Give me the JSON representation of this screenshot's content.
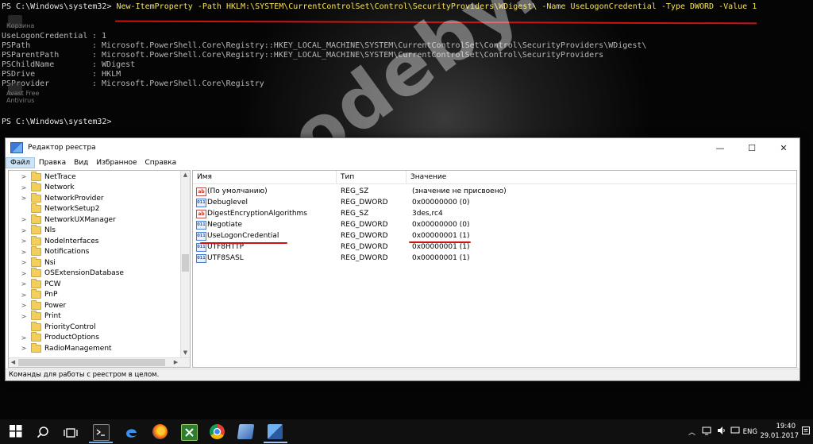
{
  "powershell": {
    "prompt1": "PS C:\\Windows\\system32> ",
    "command": "New-ItemProperty -Path HKLM:\\SYSTEM\\CurrentControlSet\\Control\\SecurityProviders\\WDigest\\ -Name UseLogonCredential -Type DWORD -Value 1",
    "output": [
      {
        "key": "UseLogonCredential",
        "value": ": 1"
      },
      {
        "key": "PSPath",
        "value": ": Microsoft.PowerShell.Core\\Registry::HKEY_LOCAL_MACHINE\\SYSTEM\\CurrentControlSet\\Control\\SecurityProviders\\WDigest\\"
      },
      {
        "key": "PSParentPath",
        "value": ": Microsoft.PowerShell.Core\\Registry::HKEY_LOCAL_MACHINE\\SYSTEM\\CurrentControlSet\\Control\\SecurityProviders"
      },
      {
        "key": "PSChildName",
        "value": ": WDigest"
      },
      {
        "key": "PSDrive",
        "value": ": HKLM"
      },
      {
        "key": "PSProvider",
        "value": ": Microsoft.PowerShell.Core\\Registry"
      }
    ],
    "prompt2": "PS C:\\Windows\\system32>"
  },
  "desktop": {
    "recycle_label": "Корзина",
    "avast_label1": "Avast Free",
    "avast_label2": "Antivirus"
  },
  "watermark": "codeby.net",
  "regedit": {
    "title": "Редактор реестра",
    "window_buttons": {
      "minimize": "—",
      "maximize": "☐",
      "close": "✕"
    },
    "menu": [
      "Файл",
      "Правка",
      "Вид",
      "Избранное",
      "Справка"
    ],
    "tree": [
      "NetTrace",
      "Network",
      "NetworkProvider",
      "NetworkSetup2",
      "NetworkUXManager",
      "Nls",
      "NodeInterfaces",
      "Notifications",
      "Nsi",
      "OSExtensionDatabase",
      "PCW",
      "PnP",
      "Power",
      "Print",
      "PriorityControl",
      "ProductOptions",
      "RadioManagement"
    ],
    "columns": {
      "name": "Имя",
      "type": "Тип",
      "value": "Значение"
    },
    "values": [
      {
        "icon": "ab",
        "name": "(По умолчанию)",
        "type": "REG_SZ",
        "data": "(значение не присвоено)"
      },
      {
        "icon": "bin",
        "name": "Debuglevel",
        "type": "REG_DWORD",
        "data": "0x00000000 (0)"
      },
      {
        "icon": "ab",
        "name": "DigestEncryptionAlgorithms",
        "type": "REG_SZ",
        "data": "3des,rc4"
      },
      {
        "icon": "bin",
        "name": "Negotiate",
        "type": "REG_DWORD",
        "data": "0x00000000 (0)"
      },
      {
        "icon": "bin",
        "name": "UseLogonCredential",
        "type": "REG_DWORD",
        "data": "0x00000001 (1)"
      },
      {
        "icon": "bin",
        "name": "UTF8HTTP",
        "type": "REG_DWORD",
        "data": "0x00000001 (1)"
      },
      {
        "icon": "bin",
        "name": "UTF8SASL",
        "type": "REG_DWORD",
        "data": "0x00000001 (1)"
      }
    ],
    "status": "Команды для работы с реестром в целом."
  },
  "taskbar": {
    "lang": "ENG",
    "time": "19:40",
    "date": "29.01.2017"
  },
  "colors": {
    "annotation": "#cc1414",
    "ps_highlight": "#f5e25a"
  }
}
